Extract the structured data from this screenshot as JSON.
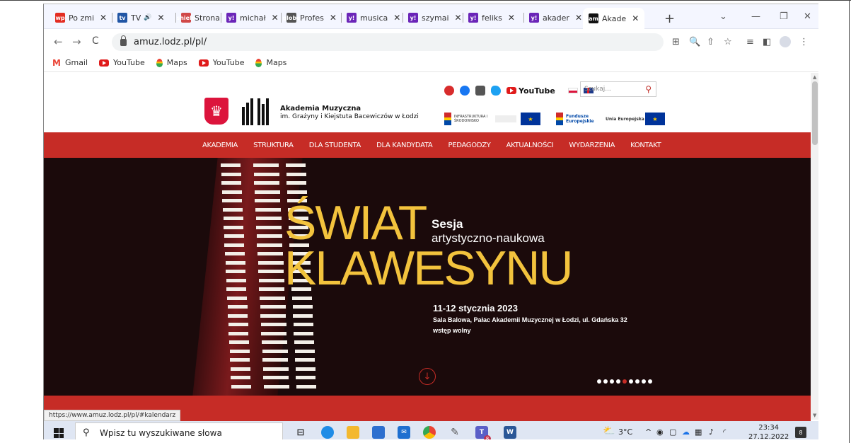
{
  "browser": {
    "tabs": [
      {
        "title": "Po zmi",
        "favicon": "wp",
        "color": "#e32d22"
      },
      {
        "title": "TV",
        "favicon": "tv",
        "color": "#2156a5",
        "audio": "🔊"
      },
      {
        "title": "Strona",
        "favicon": "shield",
        "color": "#d04848"
      },
      {
        "title": "michał",
        "favicon": "y!",
        "color": "#6b25b8"
      },
      {
        "title": "Profes",
        "favicon": "globe",
        "color": "#555555"
      },
      {
        "title": "musica",
        "favicon": "y!",
        "color": "#6b25b8"
      },
      {
        "title": "szymai",
        "favicon": "y!",
        "color": "#6b25b8"
      },
      {
        "title": "feliks",
        "favicon": "y!",
        "color": "#6b25b8"
      },
      {
        "title": "akader",
        "favicon": "y!",
        "color": "#6b25b8"
      },
      {
        "title": "Akade",
        "favicon": "am",
        "color": "#111111"
      }
    ],
    "close_glyph": "✕",
    "new_tab": "+",
    "window_controls": {
      "dropdown": "⌄",
      "minimize": "—",
      "restore": "❐",
      "close": "✕"
    },
    "nav": {
      "back": "←",
      "forward": "→",
      "reload": "C"
    },
    "url": "amuz.lodz.pl/pl/",
    "toolbar_icons": {
      "translate": "⊞",
      "zoom": "🔍",
      "share": "⇧",
      "bookmark": "☆",
      "reading": "≡",
      "sidepanel": "◧",
      "menu": "⋮"
    },
    "bookmarks": [
      {
        "label": "Gmail",
        "icon": "gmail"
      },
      {
        "label": "YouTube",
        "icon": "youtube"
      },
      {
        "label": "Maps",
        "icon": "maps"
      },
      {
        "label": "YouTube",
        "icon": "youtube"
      },
      {
        "label": "Maps",
        "icon": "maps"
      }
    ],
    "status_url": "https://www.amuz.lodz.pl/pl/#kalendarz"
  },
  "site": {
    "logo_line1": "Akademia Muzyczna",
    "logo_line2": "im. Grażyny i Kiejstuta Bacewiczów w Łodzi",
    "youtube_label": "YouTube",
    "search_placeholder": "Szukaj...",
    "eu_labels": [
      "INFRASTRUKTURA I ŚRODOWISKO",
      "Fundusze Europejskie",
      "Unia Europejska"
    ],
    "menu": [
      "AKADEMIA",
      "STRUKTURA",
      "DLA STUDENTA",
      "DLA KANDYDATA",
      "PEDAGODZY",
      "AKTUALNOŚCI",
      "WYDARZENIA",
      "KONTAKT"
    ],
    "hero": {
      "line1": "ŚWIAT",
      "line2": "KLAWESYNU",
      "sub1": "Sesja",
      "sub2": "artystyczno-naukowa",
      "date": "11-12 stycznia 2023",
      "location": "Sala Balowa, Pałac Akademii Muzycznej w Łodzi, ul. Gdańska 32",
      "entry": "wstęp wolny",
      "slides_total": 9,
      "slide_active": 5
    },
    "accent_color": "#c62c26",
    "hero_title_color": "#f3c33d"
  },
  "taskbar": {
    "search_placeholder": "Wpisz tu wyszukiwane słowa",
    "temperature": "3°C",
    "time": "23:34",
    "date": "27.12.2022",
    "teams_badge": "8",
    "notifications": "8"
  }
}
